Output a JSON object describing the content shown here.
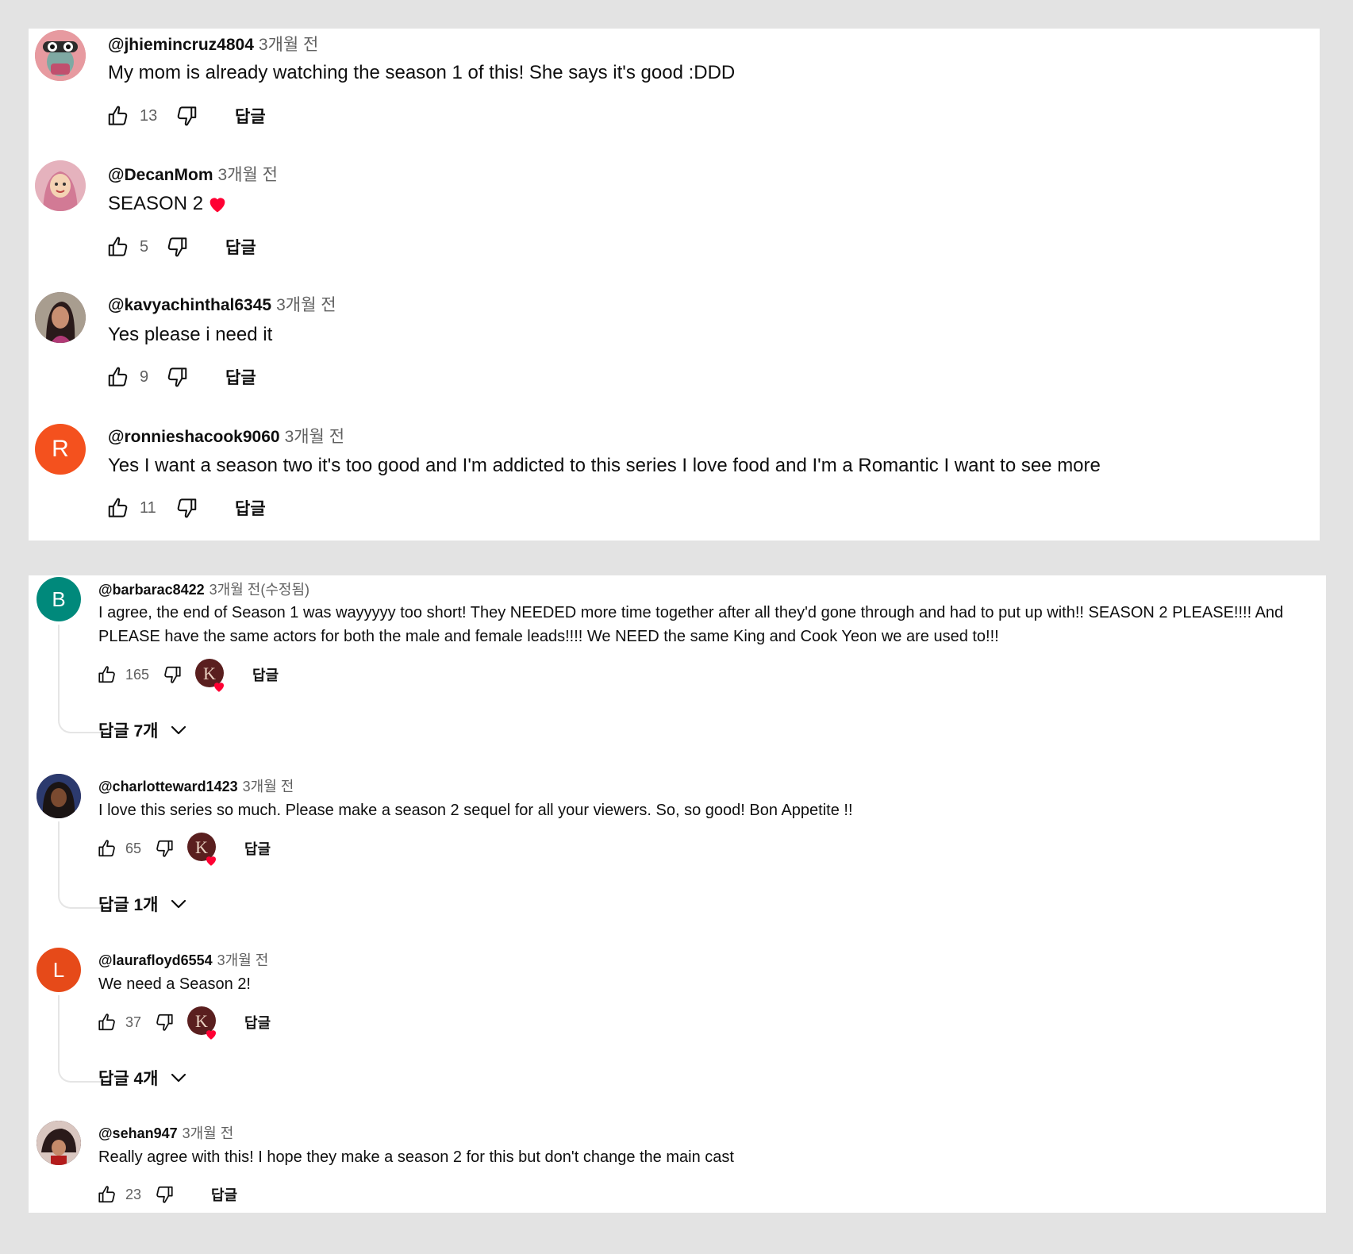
{
  "panel1": {
    "comments": [
      {
        "author": "@jhiemincruz4804",
        "time": "3개월 전",
        "text": "My mom is already watching the season 1 of this! She says it's good :DDD",
        "likes": "13",
        "reply": "답글"
      },
      {
        "author": "@DecanMom",
        "time": "3개월 전",
        "text": "SEASON 2",
        "likes": "5",
        "reply": "답글"
      },
      {
        "author": "@kavyachinthal6345",
        "time": "3개월 전",
        "text": "Yes please i need it",
        "likes": "9",
        "reply": "답글"
      },
      {
        "author": "@ronnieshacook9060",
        "time": "3개월 전",
        "text": "Yes I want a season two it's too good and I'm addicted to this series I love food and I'm a Romantic I want to see more",
        "likes": "11",
        "reply": "답글",
        "initial": "R"
      }
    ]
  },
  "panel2": {
    "comments": [
      {
        "author": "@barbarac8422",
        "time": "3개월 전(수정됨)",
        "text": "I agree, the end of Season 1 was wayyyyy too short! They NEEDED more time together after all they'd gone through and had to put up with!! SEASON 2 PLEASE!!!! And PLEASE have the same actors for both the male and female leads!!!! We NEED the same King and Cook Yeon  we are used to!!!",
        "likes": "165",
        "reply": "답글",
        "replies": "답글 7개",
        "initial": "B"
      },
      {
        "author": "@charlotteward1423",
        "time": "3개월 전",
        "text": "I love this series so much. Please make a season 2 sequel for all your viewers. So, so good! Bon Appetite !!",
        "likes": "65",
        "reply": "답글",
        "replies": "답글 1개"
      },
      {
        "author": "@laurafloyd6554",
        "time": "3개월 전",
        "text": "We need a Season 2!",
        "likes": "37",
        "reply": "답글",
        "replies": "답글 4개",
        "initial": "L"
      },
      {
        "author": "@sehan947",
        "time": "3개월 전",
        "text": "Really agree with this! I hope they make a season 2 for this but don't change the main cast",
        "likes": "23",
        "reply": "답글"
      }
    ]
  },
  "colors": {
    "avatar_r": "#f4511e",
    "avatar_b": "#00897b",
    "avatar_l": "#e64a19",
    "heart": "#ff0033"
  }
}
